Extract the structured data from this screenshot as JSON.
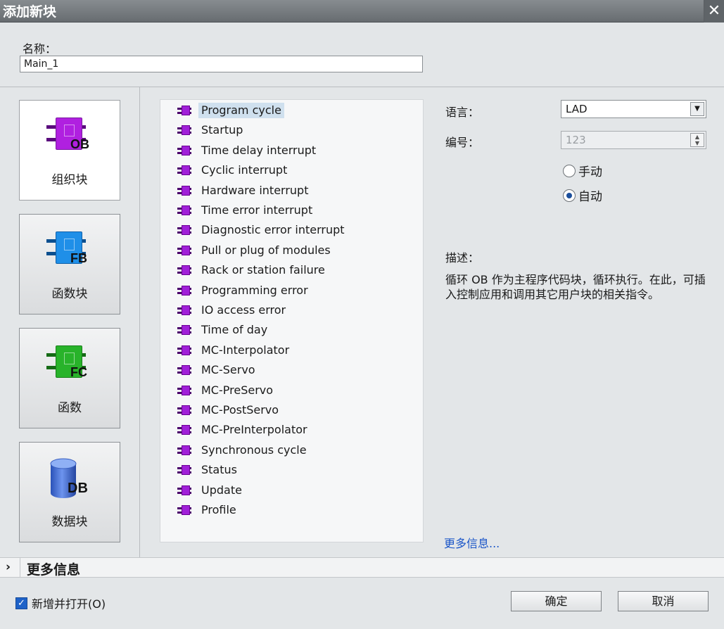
{
  "dialog": {
    "title": "添加新块",
    "close_glyph": "✕"
  },
  "name": {
    "label": "名称：",
    "value": "Main_1"
  },
  "block_types": [
    {
      "label": "组织块",
      "tag": "OB",
      "color": "#b020e0",
      "dark": "#5a0a7d"
    },
    {
      "label": "函数块",
      "tag": "FB",
      "color": "#1f8fe8",
      "dark": "#0b4f8f"
    },
    {
      "label": "函数",
      "tag": "FC",
      "color": "#28b32a",
      "dark": "#156b16"
    },
    {
      "label": "数据块",
      "tag": "DB",
      "color": "#3e6fd6",
      "dark": "#1f3f8a"
    }
  ],
  "ob_list": [
    "Program cycle",
    "Startup",
    "Time delay interrupt",
    "Cyclic interrupt",
    "Hardware interrupt",
    "Time error interrupt",
    "Diagnostic error interrupt",
    "Pull or plug of modules",
    "Rack or station failure",
    "Programming error",
    "IO access error",
    "Time of day",
    "MC-Interpolator",
    "MC-Servo",
    "MC-PreServo",
    "MC-PostServo",
    "MC-PreInterpolator",
    "Synchronous cycle",
    "Status",
    "Update",
    "Profile"
  ],
  "language": {
    "label": "语言：",
    "value": "LAD"
  },
  "number": {
    "label": "编号：",
    "value": "123"
  },
  "numbering": {
    "manual_label": "手动",
    "auto_label": "自动",
    "selected": "自动"
  },
  "description": {
    "label": "描述：",
    "text": "循环 OB 作为主程序代码块，循环执行。在此，可插入控制应用和调用其它用户块的相关指令。"
  },
  "more_info_link": "更多信息...",
  "more_info_bar": {
    "label": "更多信息",
    "chevron": "›"
  },
  "add_and_open": {
    "label": "新增并打开(O)",
    "checked": true
  },
  "buttons": {
    "ok": "确定",
    "cancel": "取消"
  }
}
